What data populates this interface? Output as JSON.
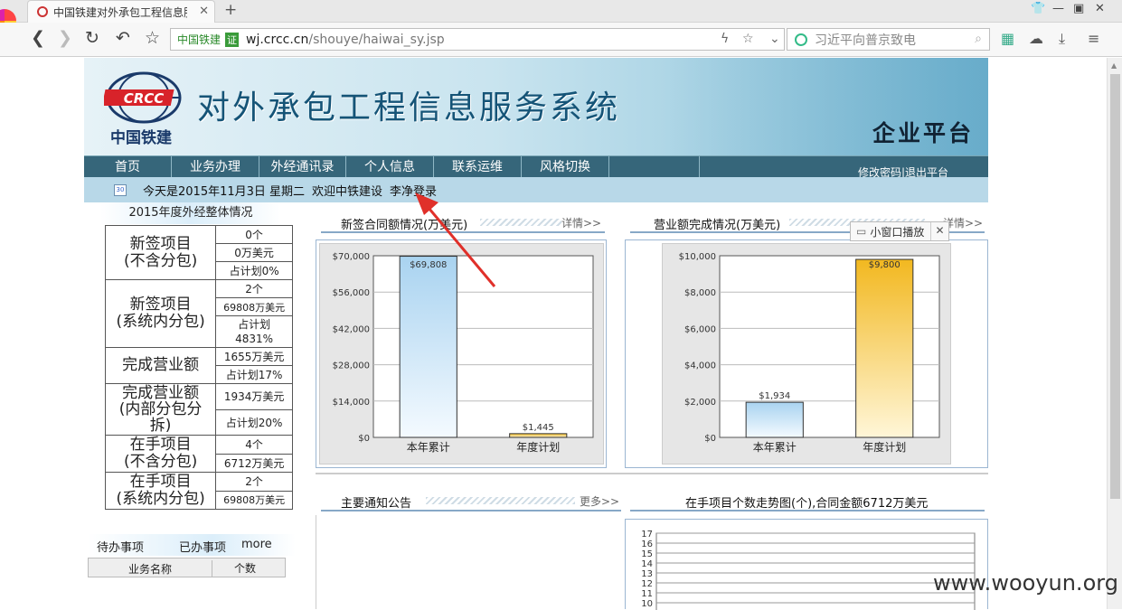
{
  "browser": {
    "tab_title": "中国铁建对外承包工程信息服务",
    "org_label": "中国铁建",
    "cert_label": "证",
    "url_host": "wj.crcc.cn",
    "url_path": "/shouye/haiwai_sy.jsp",
    "search_placeholder": "习近平向普京致电"
  },
  "banner": {
    "logo_text": "CRCC",
    "company": "中国铁建",
    "title": "对外承包工程信息服务系统",
    "platform": "企业平台"
  },
  "menu": {
    "items": [
      "首页",
      "业务办理",
      "外经通讯录",
      "个人信息",
      "联系运维",
      "风格切换"
    ],
    "right": "修改密码|退出平台"
  },
  "welcome": {
    "calendar_day": "30",
    "date": "今天是2015年11月3日 星期二",
    "greeting": "欢迎中铁建设",
    "user": "李净登录"
  },
  "summary": {
    "caption": "2015年度外经整体情况",
    "rows": [
      {
        "label": "新签项目\n(不含分包)",
        "values": [
          "0个",
          "0万美元",
          "占计划0%"
        ]
      },
      {
        "label": "新签项目\n(系统内分包)",
        "values": [
          "2个",
          "69808万美元",
          "占计划\n4831%"
        ]
      },
      {
        "label": "完成营业额",
        "values": [
          "1655万美元",
          "占计划17%"
        ]
      },
      {
        "label": "完成营业额\n(内部分包分\n拆)",
        "values": [
          "1934万美元",
          "占计划20%"
        ]
      },
      {
        "label": "在手项目\n(不含分包)",
        "values": [
          "4个",
          "6712万美元"
        ]
      },
      {
        "label": "在手项目\n(系统内分包)",
        "values": [
          "2个",
          "69808万美元"
        ]
      }
    ]
  },
  "todo": {
    "tabs": [
      "待办事项",
      "已办事项",
      "more"
    ],
    "columns": [
      "业务名称",
      "个数"
    ]
  },
  "panels": {
    "contract": {
      "title": "新签合同额情况(万美元)",
      "more": "详情>>"
    },
    "revenue": {
      "title": "营业额完成情况(万美元)",
      "more": "详情>>"
    },
    "notice": {
      "title": "主要通知公告",
      "more": "更多>>"
    },
    "trend": {
      "title": "在手项目个数走势图(个),合同金额6712万美元"
    }
  },
  "popup": {
    "label": "小窗口播放",
    "close": "✕"
  },
  "watermark": "www.wooyun.org",
  "colors": {
    "menu": "#36667a",
    "welcome_bar": "#b8d8e8",
    "bar_blue": "#a9d3f0",
    "bar_gold": "#f2b820",
    "annotation_arrow": "#e0302a"
  },
  "chart_data": [
    {
      "type": "bar",
      "categories": [
        "本年累计",
        "年度计划"
      ],
      "values": [
        69808,
        1445
      ],
      "value_labels": [
        "$69,808",
        "$1,445"
      ],
      "ylim": [
        0,
        70000
      ],
      "yticks": [
        "$0",
        "$14,000",
        "$28,000",
        "$42,000",
        "$56,000",
        "$70,000"
      ],
      "colors": [
        "#a9d3f0",
        "#f2b820"
      ]
    },
    {
      "type": "bar",
      "categories": [
        "本年累计",
        "年度计划"
      ],
      "values": [
        1934,
        9800
      ],
      "value_labels": [
        "$1,934",
        "$9,800"
      ],
      "ylim": [
        0,
        10000
      ],
      "yticks": [
        "$0",
        "$2,000",
        "$4,000",
        "$6,000",
        "$8,000",
        "$10,000"
      ],
      "colors": [
        "#a9d3f0",
        "#f2b820"
      ]
    },
    {
      "type": "line",
      "yticks": [
        "10",
        "11",
        "12",
        "13",
        "14",
        "15",
        "16",
        "17"
      ],
      "ylim": [
        10,
        17
      ]
    }
  ]
}
